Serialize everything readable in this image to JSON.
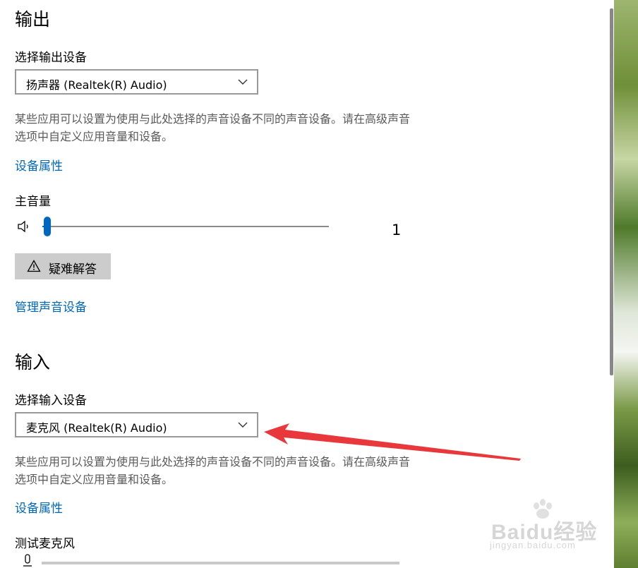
{
  "output": {
    "heading": "输出",
    "select_label": "选择输出设备",
    "device_value": "扬声器 (Realtek(R) Audio)",
    "description": "某些应用可以设置为使用与此处选择的声音设备不同的声音设备。请在高级声音选项中自定义应用音量和设备。",
    "properties_link": "设备属性",
    "volume_label": "主音量",
    "volume_value": "1",
    "volume_level": 0.01,
    "troubleshoot_label": "疑难解答",
    "manage_link": "管理声音设备"
  },
  "input": {
    "heading": "输入",
    "select_label": "选择输入设备",
    "device_value": "麦克风 (Realtek(R) Audio)",
    "description": "某些应用可以设置为使用与此处选择的声音设备不同的声音设备。请在高级声音选项中自定义应用音量和设备。",
    "properties_link": "设备属性",
    "test_label": "测试麦克风"
  },
  "watermark": {
    "brand": "Baidu经验",
    "url": "jingyan.baidu.com"
  },
  "icons": {
    "volume": "speaker-icon",
    "warning": "warning-icon",
    "microphone": "microphone-icon",
    "chevron": "chevron-down-icon"
  },
  "colors": {
    "accent": "#0067c0",
    "link": "#0067b8",
    "annotation_arrow": "#e8383b"
  }
}
